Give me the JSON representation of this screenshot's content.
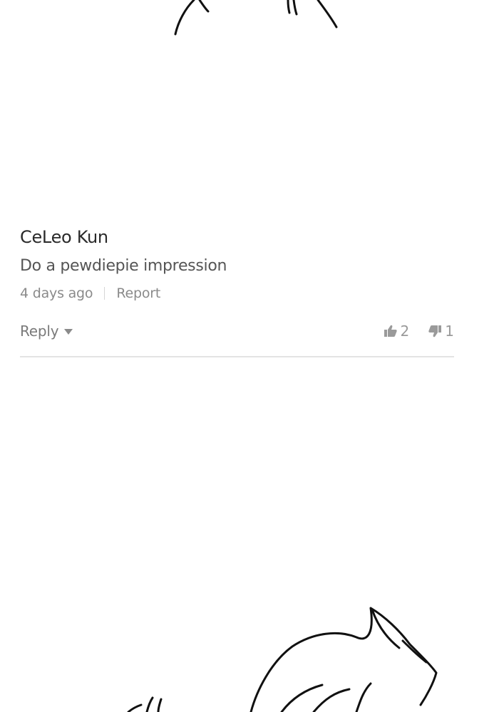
{
  "comment": {
    "author": "CeLeo Kun",
    "text": "Do a pewdiepie impression",
    "timestamp": "4 days ago",
    "report_label": "Report",
    "reply_label": "Reply",
    "upvotes": "2",
    "downvotes": "1"
  },
  "icons": {
    "reply_toggle": "caret-down-icon",
    "upvote": "thumbs-up-icon",
    "downvote": "thumbs-down-icon"
  },
  "colors": {
    "author": "#2a2a2a",
    "text": "#555555",
    "muted": "#8a8a8a",
    "divider": "#e3e3e3"
  }
}
